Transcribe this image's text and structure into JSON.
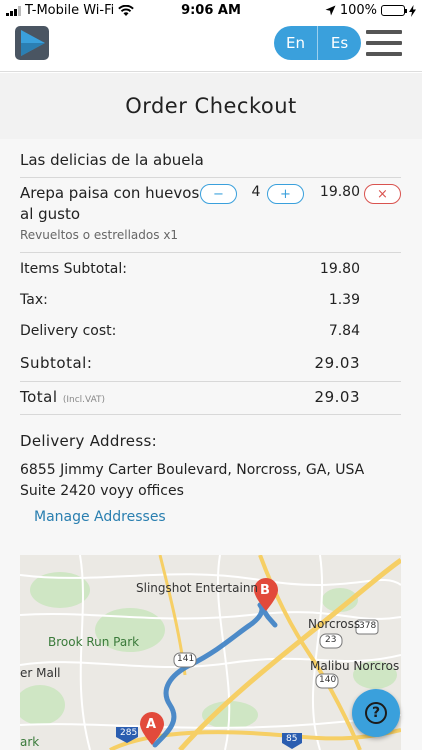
{
  "status": {
    "carrier": "T-Mobile Wi-Fi",
    "time": "9:06 AM",
    "battery": "100%"
  },
  "header": {
    "lang_en": "En",
    "lang_es": "Es",
    "brand_color": "#3aa0dc"
  },
  "title": "Order Checkout",
  "order": {
    "restaurant": "Las delicias de la abuela",
    "item": {
      "name": "Arepa paisa con huevos al gusto",
      "description": "Revueltos o estrellados x1",
      "quantity": "4",
      "price": "19.80",
      "minus": "−",
      "plus": "+",
      "remove": "×"
    },
    "summary": {
      "items_subtotal_label": "Items Subtotal:",
      "items_subtotal": "19.80",
      "tax_label": "Tax:",
      "tax": "1.39",
      "delivery_label": "Delivery cost:",
      "delivery": "7.84",
      "subtotal_label": "Subtotal:",
      "subtotal": "29.03",
      "total_label": "Total",
      "total_note": "(Incl.VAT)",
      "total": "29.03"
    }
  },
  "delivery": {
    "heading": "Delivery Address:",
    "line1": "6855 Jimmy Carter Boulevard, Norcross, GA, USA",
    "line2": "Suite 2420 voyy offices",
    "manage": "Manage Addresses"
  },
  "map": {
    "labels": {
      "slingshot": "Slingshot Entertainn",
      "norcross": "Norcross",
      "brook_run": "Brook Run Park",
      "malibu": "Malibu Norcros",
      "mall": "er Mall",
      "park": "ark",
      "r378": "378",
      "r23": "23",
      "r141": "141",
      "r140": "140",
      "i285": "285",
      "i85": "85"
    },
    "marker_a": "A",
    "marker_b": "B"
  },
  "help": "?"
}
